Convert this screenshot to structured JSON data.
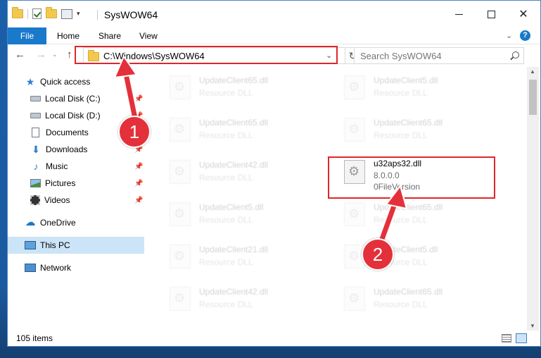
{
  "window": {
    "title": "SysWOW64",
    "min_glyph": "—",
    "close_glyph": "✕"
  },
  "ribbon": {
    "tabs": [
      {
        "label": "File"
      },
      {
        "label": "Home"
      },
      {
        "label": "Share"
      },
      {
        "label": "View"
      }
    ],
    "help_glyph": "?",
    "expand_glyph": "⌄"
  },
  "nav": {
    "back_glyph": "←",
    "forward_glyph": "→",
    "recent_glyph": "⌄",
    "up_glyph": "↑",
    "address": "C:\\Windows\\SysWOW64",
    "address_drop_glyph": "⌄",
    "refresh_glyph": "↻",
    "search_placeholder": "Search SysWOW64"
  },
  "sidebar": {
    "items": [
      {
        "label": "Quick access"
      },
      {
        "label": "Local Disk (C:)"
      },
      {
        "label": "Local Disk (D:)"
      },
      {
        "label": "Documents"
      },
      {
        "label": "Downloads"
      },
      {
        "label": "Music"
      },
      {
        "label": "Pictures"
      },
      {
        "label": "Videos"
      },
      {
        "label": "OneDrive"
      },
      {
        "label": "This PC"
      },
      {
        "label": "Network"
      }
    ],
    "pin_glyph": "📌"
  },
  "files": {
    "left": [
      {
        "name": "UpdateClient65.dll",
        "type": "Resource DLL"
      },
      {
        "name": "UpdateClient65.dll",
        "type": "Resource DLL"
      },
      {
        "name": "UpdateClient42.dll",
        "type": "Resource DLL"
      },
      {
        "name": "UpdateClient5.dll",
        "type": "Resource DLL"
      },
      {
        "name": "UpdateClient21.dll",
        "type": "Resource DLL"
      },
      {
        "name": "UpdateClient42.dll",
        "type": "Resource DLL"
      }
    ],
    "right": [
      {
        "name": "UpdateClient5.dll",
        "type": "Resource DLL"
      },
      {
        "name": "UpdateClient65.dll",
        "type": "Resource DLL"
      },
      {
        "name": "UpdateClient65.dll",
        "type": "Resource DLL"
      },
      {
        "name": "UpdateClient5.dll",
        "type": "Resource DLL"
      },
      {
        "name": "UpdateClient65.dll",
        "type": "Resource DLL"
      }
    ],
    "featured": {
      "name": "u32aps32.dll",
      "version": "8.0.0.0",
      "description": "0FileVersion"
    }
  },
  "status": {
    "item_count": "105 items"
  },
  "annotations": {
    "step1": "1",
    "step2": "2"
  },
  "colors": {
    "accent": "#1979ca",
    "highlight_red": "#e0262a",
    "badge_red": "#e4303a",
    "selected_bg": "#cce4f7"
  }
}
